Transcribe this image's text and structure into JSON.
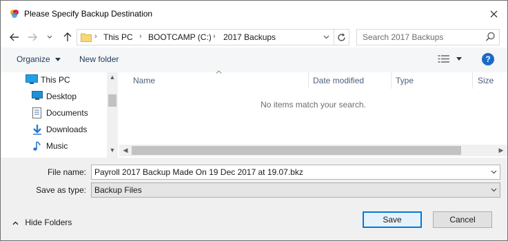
{
  "window": {
    "title": "Please Specify Backup Destination"
  },
  "breadcrumb": [
    "This PC",
    "BOOTCAMP (C:)",
    "2017 Backups"
  ],
  "search": {
    "placeholder": "Search 2017 Backups"
  },
  "toolbar": {
    "organize_label": "Organize",
    "new_folder_label": "New folder"
  },
  "nav_pane": {
    "items": [
      {
        "label": "This PC",
        "icon": "computer-icon"
      },
      {
        "label": "Desktop",
        "icon": "desktop-icon"
      },
      {
        "label": "Documents",
        "icon": "documents-icon"
      },
      {
        "label": "Downloads",
        "icon": "downloads-icon"
      },
      {
        "label": "Music",
        "icon": "music-icon"
      }
    ]
  },
  "file_list": {
    "columns": [
      "Name",
      "Date modified",
      "Type",
      "Size"
    ],
    "empty_message": "No items match your search."
  },
  "form": {
    "file_name_label": "File name:",
    "file_name_value": "Payroll 2017 Backup Made On 19 Dec 2017 at 19.07.bkz",
    "save_type_label": "Save as type:",
    "save_type_value": "Backup Files"
  },
  "footer": {
    "hide_folders_label": "Hide Folders",
    "save_label": "Save",
    "cancel_label": "Cancel"
  },
  "colors": {
    "accent": "#0078d7",
    "help": "#1b6ac9",
    "link_text": "#1e395b",
    "header_text": "#4c607a"
  }
}
